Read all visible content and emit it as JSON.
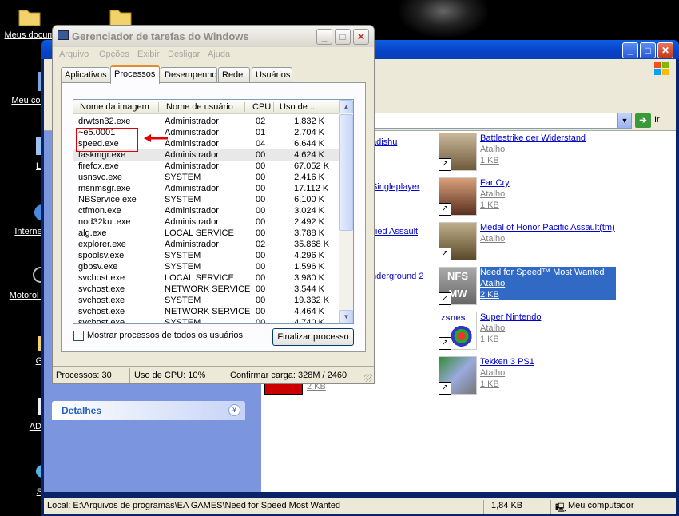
{
  "desktop": {
    "icons": [
      {
        "label": "Meus docum"
      },
      {
        "label": "Meu com"
      },
      {
        "label": "Lix"
      },
      {
        "label": "Internet"
      },
      {
        "label": "Motorol Tc"
      },
      {
        "label": "Ga"
      },
      {
        "label": "ADP"
      },
      {
        "label": "Sk"
      }
    ]
  },
  "explorer": {
    "address_go": "Ir",
    "details_panel": "Detalhes",
    "items": [
      {
        "name": "Battlestrike der Widerstand",
        "line2": "Atalho",
        "line3": "1 KB",
        "icon": "soldier-icon"
      },
      {
        "name": "Far Cry",
        "line2": "Atalho",
        "line3": "1 KB",
        "icon": "farcry-icon"
      },
      {
        "name": "Medal of Honor Pacific Assault(tm)",
        "line2": "Atalho",
        "line3": "",
        "icon": "moh-icon"
      },
      {
        "name": "Need for Speed™ Most Wanted",
        "line2": "Atalho",
        "line3": "2 KB",
        "icon": "nfs-icon",
        "selected": true
      },
      {
        "name": "Super Nintendo",
        "line2": "Atalho",
        "line3": "1 KB",
        "icon": "zsnes-icon"
      },
      {
        "name": "Tekken 3 PS1",
        "line2": "Atalho",
        "line3": "1 KB",
        "icon": "tekken-icon"
      }
    ],
    "partial_left": [
      "adishu",
      "Singleplayer",
      "llied Assault",
      "nderground 2",
      "2 KB"
    ],
    "status": {
      "location": "Local: E:\\Arquivos de programas\\EA GAMES\\Need for Speed Most Wanted",
      "size": "1,84 KB",
      "zone": "Meu computador"
    }
  },
  "taskmanager": {
    "title": "Gerenciador de tarefas do Windows",
    "menu": [
      "Arquivo",
      "Opções",
      "Exibir",
      "Desligar",
      "Ajuda"
    ],
    "tabs": [
      "Aplicativos",
      "Processos",
      "Desempenho",
      "Rede",
      "Usuários"
    ],
    "active_tab": "Processos",
    "columns": [
      "Nome da imagem",
      "Nome de usuário",
      "CPU",
      "Uso de ..."
    ],
    "rows": [
      [
        "drwtsn32.exe",
        "Administrador",
        "02",
        "1.832 K"
      ],
      [
        "~e5.0001",
        "Administrador",
        "01",
        "2.704 K"
      ],
      [
        "speed.exe",
        "Administrador",
        "04",
        "6.644 K"
      ],
      [
        "taskmgr.exe",
        "Administrador",
        "00",
        "4.624 K"
      ],
      [
        "firefox.exe",
        "Administrador",
        "00",
        "67.052 K"
      ],
      [
        "usnsvc.exe",
        "SYSTEM",
        "00",
        "2.416 K"
      ],
      [
        "msnmsgr.exe",
        "Administrador",
        "00",
        "17.112 K"
      ],
      [
        "NBService.exe",
        "SYSTEM",
        "00",
        "6.100 K"
      ],
      [
        "ctfmon.exe",
        "Administrador",
        "00",
        "3.024 K"
      ],
      [
        "nod32kui.exe",
        "Administrador",
        "00",
        "2.492 K"
      ],
      [
        "alg.exe",
        "LOCAL SERVICE",
        "00",
        "3.788 K"
      ],
      [
        "explorer.exe",
        "Administrador",
        "02",
        "35.868 K"
      ],
      [
        "spoolsv.exe",
        "SYSTEM",
        "00",
        "4.296 K"
      ],
      [
        "gbpsv.exe",
        "SYSTEM",
        "00",
        "1.596 K"
      ],
      [
        "svchost.exe",
        "LOCAL SERVICE",
        "00",
        "3.980 K"
      ],
      [
        "svchost.exe",
        "NETWORK SERVICE",
        "00",
        "3.544 K"
      ],
      [
        "svchost.exe",
        "SYSTEM",
        "00",
        "19.332 K"
      ],
      [
        "svchost.exe",
        "NETWORK SERVICE",
        "00",
        "4.464 K"
      ],
      [
        "svchost.exe",
        "SYSTEM",
        "00",
        "4.740 K"
      ]
    ],
    "selected_row": 3,
    "show_all_label": "Mostrar processos de todos os usuários",
    "end_process_label": "Finalizar processo",
    "status": {
      "processes": "Processos: 30",
      "cpu": "Uso de CPU: 10%",
      "commit": "Confirmar carga: 328M / 2460"
    }
  }
}
